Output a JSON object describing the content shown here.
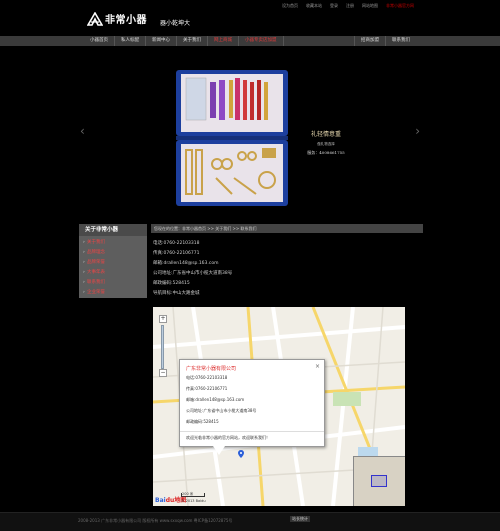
{
  "header": {
    "logo_text": "非常小器",
    "slogan": "器小乾坤大",
    "top_links": [
      "设为首页",
      "收藏本站",
      "登录",
      "注册",
      "网站地图"
    ],
    "top_highlight": "非常小器官方网"
  },
  "nav": {
    "items": [
      "小器首页",
      "私人标配",
      "新闻中心",
      "关于我们",
      "网上商城",
      "小器专卖店加盟"
    ],
    "right_items": [
      "招商加盟",
      "联系我们"
    ]
  },
  "banner": {
    "caption_title": "礼轻情意重",
    "caption_sub": "做礼物选择",
    "caption_phone": "服务：4008661755"
  },
  "sidebar": {
    "title": "关于非常小器",
    "items": [
      "关于我们",
      "品牌理念",
      "品牌荣誉",
      "大事年表",
      "联系我们",
      "企业荣誉"
    ]
  },
  "content": {
    "breadcrumb": "您现在的位置：非常小器首页 >> 关于我们 >> 联系我们",
    "contact": [
      "电话:0760-22103318",
      "传真:0760-22106771",
      "邮箱:drallen148@sp.163.com",
      "公司地址:广东省中山市小榄大道南38号",
      "邮政编码:528415",
      "导航目标:中山大路金城"
    ]
  },
  "map": {
    "info_title": "广东非常小器有限公司",
    "info_lines": [
      "电话:0760-22103318",
      "传真:0760-22106771",
      "邮箱:drallen148@sp.163.com",
      "公司地址:广东省中山市小榄大道南38号",
      "邮政编码:528415"
    ],
    "info_footer": "欢迎光临非常小器的官方网站，欢迎联系我们！",
    "close_glyph": "×",
    "zoom_in": "+",
    "zoom_out": "−",
    "scale_label": "200 米",
    "brand_left": "Bai",
    "brand_right": "du地图",
    "copyright": "© 2013 Baidu"
  },
  "footer": {
    "text": "2008-2013 广东非常小器有限公司 版权所有 www.sxxqw.com 粤ICP备12072875号",
    "badge": "站长统计"
  },
  "colors": {
    "accent_red": "#e23b3b",
    "nav_bg": "#3a3a3a",
    "sidebar_bg": "#5e5e5e"
  }
}
